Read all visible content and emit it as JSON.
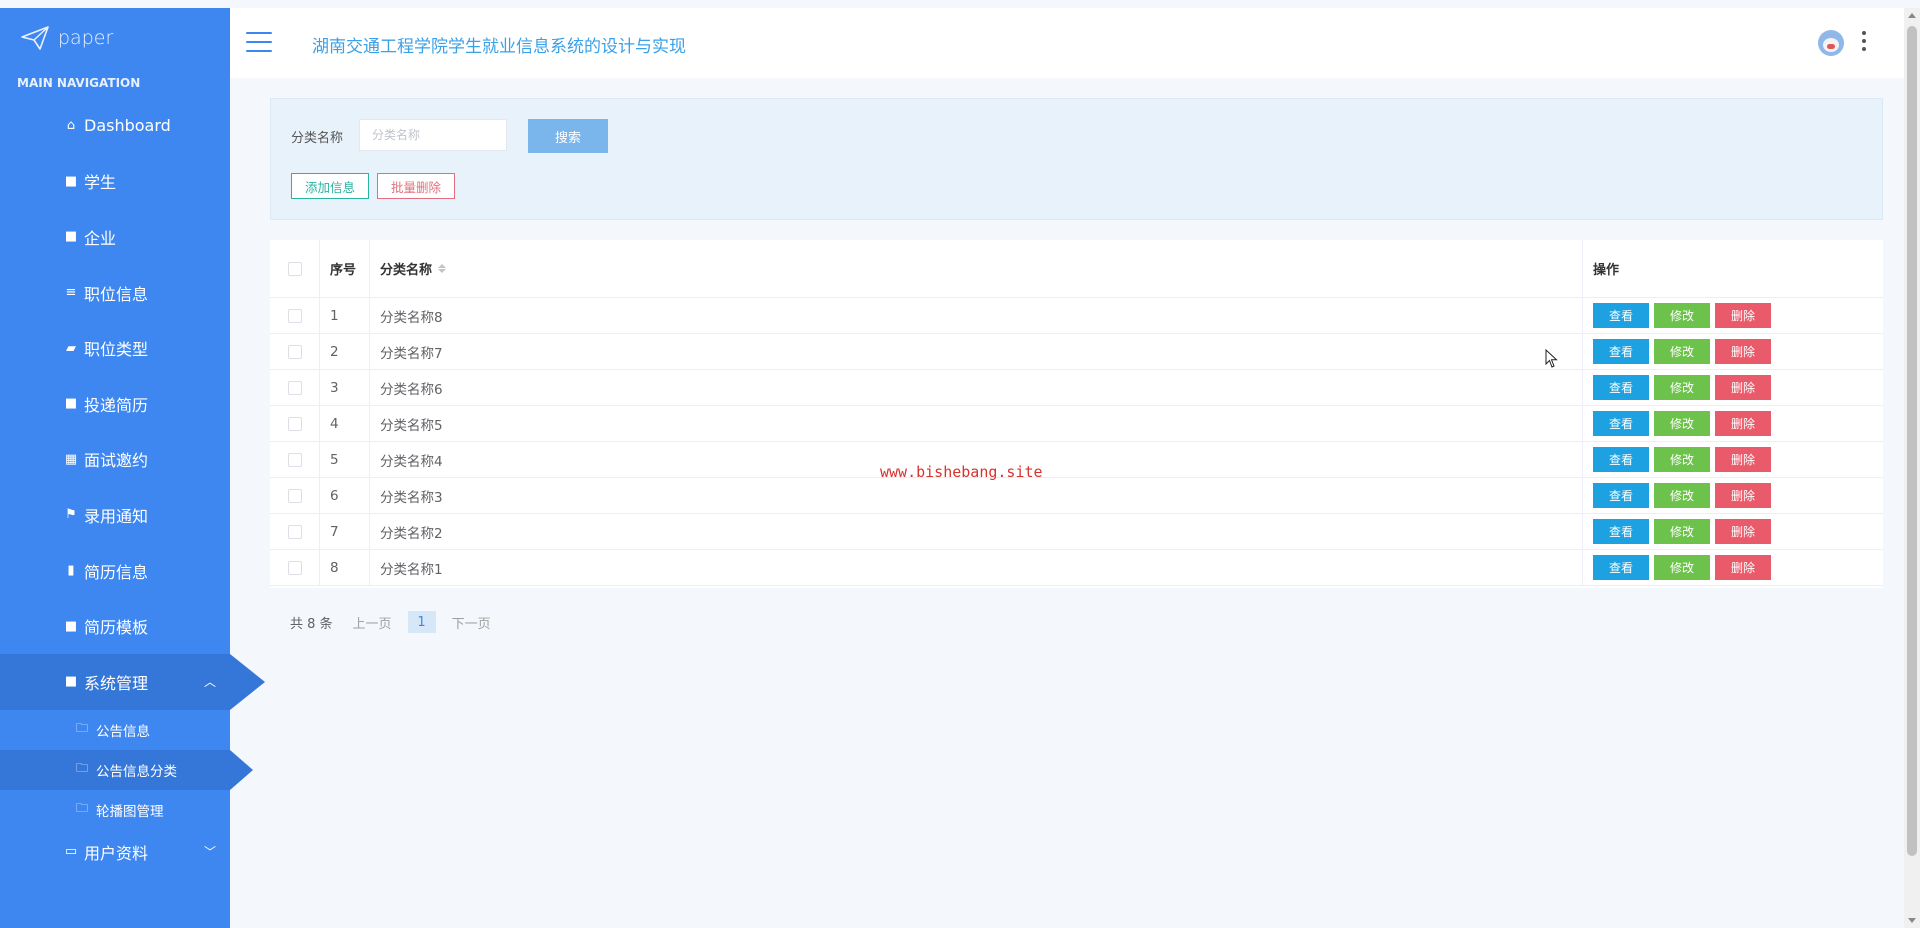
{
  "sidebar": {
    "brand": "paper",
    "nav_title": "MAIN NAVIGATION",
    "items": [
      {
        "label": "Dashboard",
        "icon": "home-icon"
      },
      {
        "label": "学生",
        "icon": "grid-icon"
      },
      {
        "label": "企业",
        "icon": "grid-icon"
      },
      {
        "label": "职位信息",
        "icon": "list-icon"
      },
      {
        "label": "职位类型",
        "icon": "briefcase-icon"
      },
      {
        "label": "投递简历",
        "icon": "grid-icon"
      },
      {
        "label": "面试邀约",
        "icon": "table-icon"
      },
      {
        "label": "录用通知",
        "icon": "flag-icon"
      },
      {
        "label": "简历信息",
        "icon": "clipboard-icon"
      },
      {
        "label": "简历模板",
        "icon": "grid-icon"
      },
      {
        "label": "系统管理",
        "icon": "grid-icon"
      }
    ],
    "sub_items": [
      {
        "label": "公告信息"
      },
      {
        "label": "公告信息分类"
      },
      {
        "label": "轮播图管理"
      }
    ],
    "user_profile": "用户资料"
  },
  "header": {
    "title": "湖南交通工程学院学生就业信息系统的设计与实现"
  },
  "search": {
    "label": "分类名称",
    "placeholder": "分类名称",
    "button": "搜索",
    "add_button": "添加信息",
    "batch_delete_button": "批量删除"
  },
  "table": {
    "columns": {
      "index": "序号",
      "name": "分类名称",
      "ops": "操作"
    },
    "rows": [
      {
        "index": "1",
        "name": "分类名称8"
      },
      {
        "index": "2",
        "name": "分类名称7"
      },
      {
        "index": "3",
        "name": "分类名称6"
      },
      {
        "index": "4",
        "name": "分类名称5"
      },
      {
        "index": "5",
        "name": "分类名称4"
      },
      {
        "index": "6",
        "name": "分类名称3"
      },
      {
        "index": "7",
        "name": "分类名称2"
      },
      {
        "index": "8",
        "name": "分类名称1"
      }
    ],
    "row_actions": {
      "view": "查看",
      "edit": "修改",
      "delete": "删除"
    }
  },
  "pagination": {
    "total": "共 8 条",
    "prev": "上一页",
    "current": "1",
    "next": "下一页"
  },
  "watermark": "www.bishebang.site",
  "colors": {
    "sidebar": "#3f87f0",
    "sidebar_active": "#3577d8",
    "view": "#1ea1e0",
    "edit": "#6cc24a",
    "delete": "#e95b6a"
  }
}
